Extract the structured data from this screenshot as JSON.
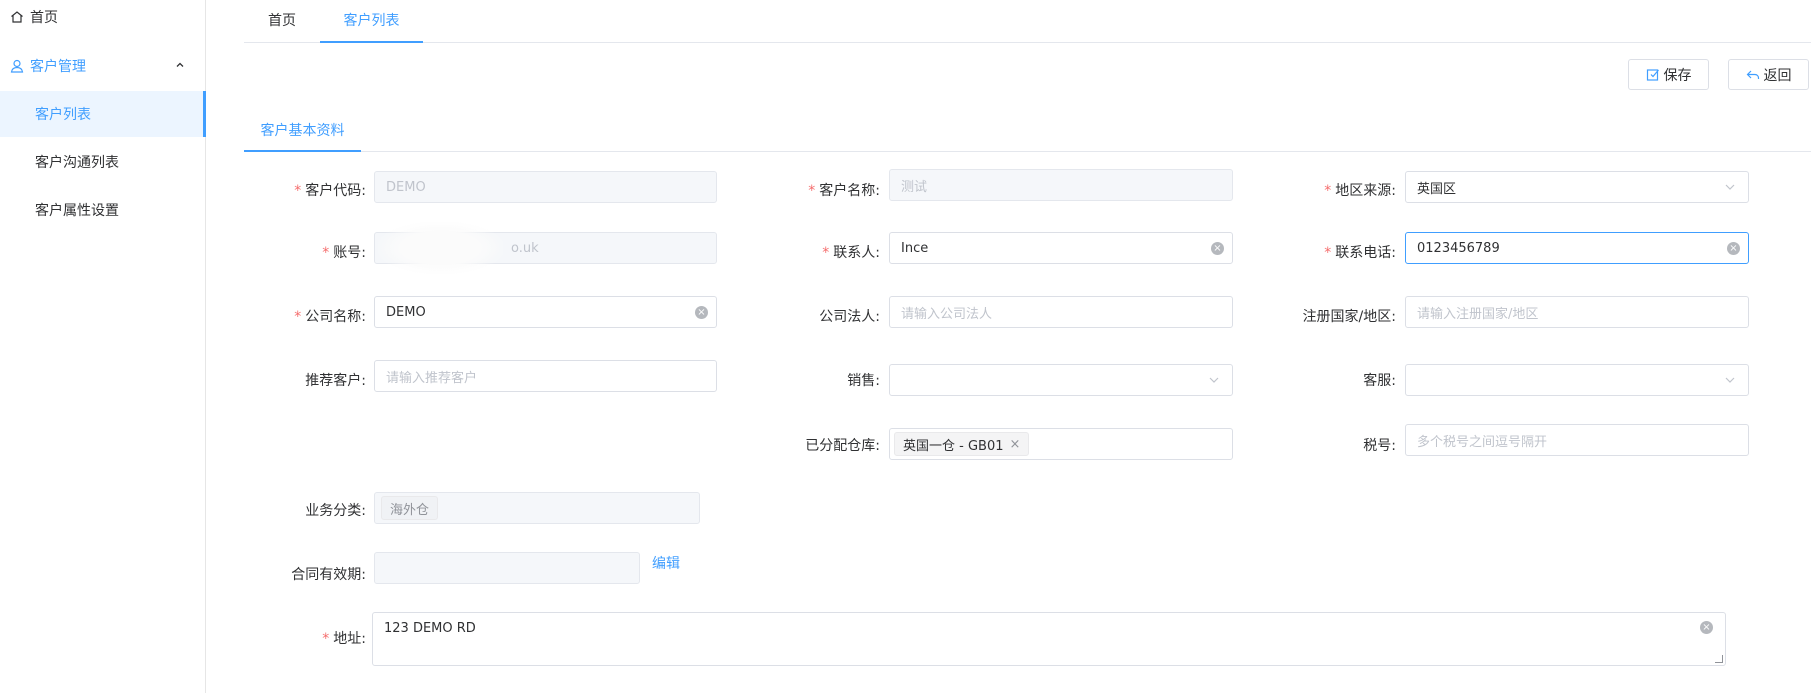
{
  "sidebar": {
    "home": "首页",
    "group": "客户管理",
    "items": [
      "客户列表",
      "客户沟通列表",
      "客户属性设置"
    ]
  },
  "tabs": {
    "home": "首页",
    "customer_list": "客户列表"
  },
  "actions": {
    "save": "保存",
    "back": "返回"
  },
  "section_tab": "客户基本资料",
  "form": {
    "customer_code": {
      "label": "客户代码:",
      "value": "DEMO"
    },
    "customer_name": {
      "label": "客户名称:",
      "value": "测试"
    },
    "region_source": {
      "label": "地区来源:",
      "value": "英国区"
    },
    "account": {
      "label": "账号:",
      "value": "o.uk"
    },
    "contact": {
      "label": "联系人:",
      "value": "Ince"
    },
    "phone": {
      "label": "联系电话:",
      "value": "0123456789"
    },
    "company_name": {
      "label": "公司名称:",
      "value": "DEMO"
    },
    "legal_person": {
      "label": "公司法人:",
      "placeholder": "请输入公司法人"
    },
    "reg_country": {
      "label": "注册国家/地区:",
      "placeholder": "请输入注册国家/地区"
    },
    "referrer": {
      "label": "推荐客户:",
      "placeholder": "请输入推荐客户"
    },
    "sales": {
      "label": "销售:"
    },
    "service": {
      "label": "客服:"
    },
    "warehouse": {
      "label": "已分配仓库:",
      "tag": "英国一仓 - GB01",
      "tag_close": "×"
    },
    "tax_no": {
      "label": "税号:",
      "placeholder": "多个税号之间逗号隔开"
    },
    "biz_category": {
      "label": "业务分类:",
      "tag": "海外仓"
    },
    "contract_period": {
      "label": "合同有效期:",
      "edit": "编辑"
    },
    "address": {
      "label": "地址:",
      "value": "123 DEMO RD"
    }
  },
  "required_mark": "*",
  "colors": {
    "accent": "#409eff",
    "required": "#f56c6c"
  }
}
